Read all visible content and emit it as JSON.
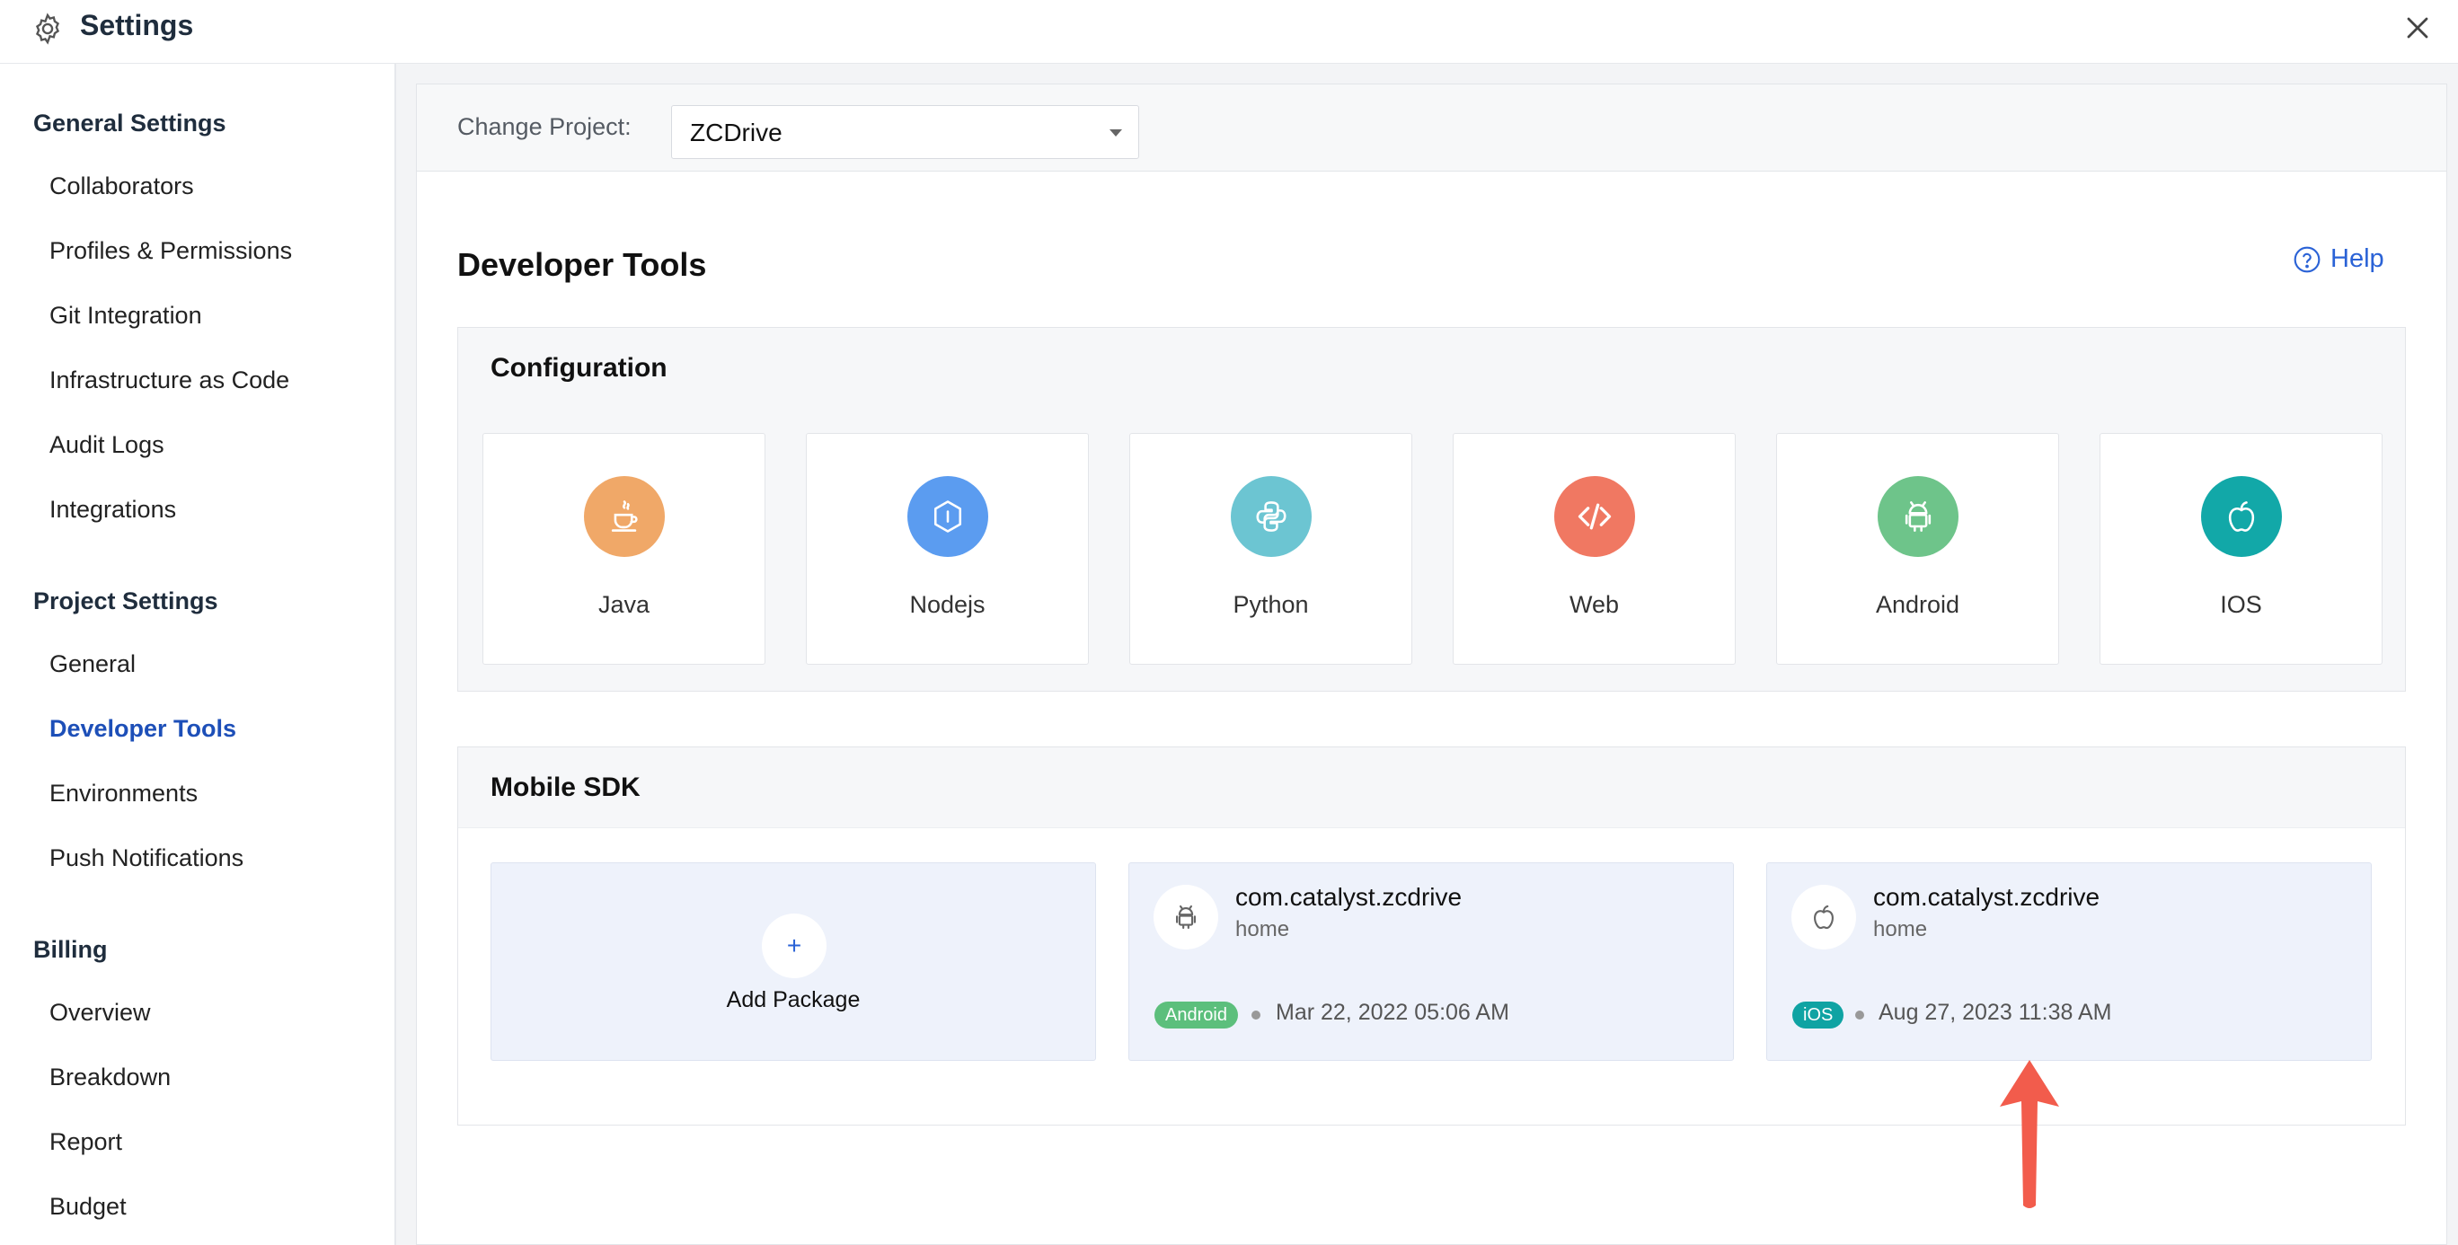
{
  "header": {
    "title": "Settings"
  },
  "sidebar": {
    "general_heading": "General Settings",
    "general_items": [
      "Collaborators",
      "Profiles & Permissions",
      "Git Integration",
      "Infrastructure as Code",
      "Audit Logs",
      "Integrations"
    ],
    "project_heading": "Project Settings",
    "project_items": [
      "General",
      "Developer Tools",
      "Environments",
      "Push Notifications"
    ],
    "billing_heading": "Billing",
    "billing_items": [
      "Overview",
      "Breakdown",
      "Report",
      "Budget"
    ],
    "active_item": "Developer Tools"
  },
  "project": {
    "label": "Change Project:",
    "selected": "ZCDrive"
  },
  "page": {
    "title": "Developer Tools",
    "help_label": "Help"
  },
  "configuration": {
    "title": "Configuration",
    "tiles": [
      {
        "label": "Java",
        "icon": "java-icon",
        "color": "#f0a868"
      },
      {
        "label": "Nodejs",
        "icon": "nodejs-icon",
        "color": "#5b9cf0"
      },
      {
        "label": "Python",
        "icon": "python-icon",
        "color": "#6cc5d2"
      },
      {
        "label": "Web",
        "icon": "code-icon",
        "color": "#f07862"
      },
      {
        "label": "Android",
        "icon": "android-icon",
        "color": "#6ec48a"
      },
      {
        "label": "IOS",
        "icon": "apple-icon",
        "color": "#12a8a8"
      }
    ]
  },
  "mobile_sdk": {
    "title": "Mobile SDK",
    "add_label": "Add Package",
    "add_symbol": "+",
    "packages": [
      {
        "name": "com.catalyst.zcdrive",
        "sub": "home",
        "badge": "Android",
        "badge_color": "#5cbf7c",
        "date": "Mar 22, 2022 05:06 AM",
        "icon": "android-icon"
      },
      {
        "name": "com.catalyst.zcdrive",
        "sub": "home",
        "badge": "iOS",
        "badge_color": "#0fa3a3",
        "date": "Aug 27, 2023 11:38 AM",
        "icon": "apple-icon"
      }
    ]
  },
  "annotation": {
    "arrow_color": "#f25c4c"
  }
}
